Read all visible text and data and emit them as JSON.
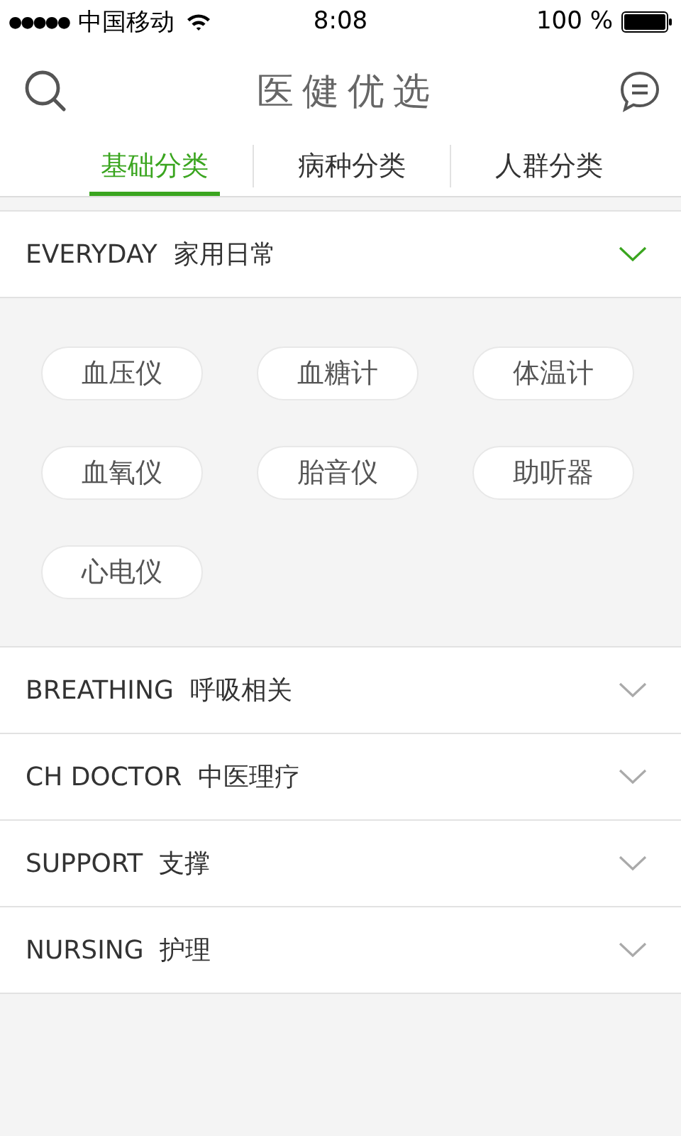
{
  "status_bar": {
    "signal_dots": "●●●●●",
    "carrier": "中国移动",
    "time": "8:08",
    "battery": "100 %"
  },
  "header": {
    "title": "医健优选"
  },
  "tabs": [
    {
      "label": "基础分类",
      "selected": true
    },
    {
      "label": "病种分类",
      "selected": false
    },
    {
      "label": "人群分类",
      "selected": false
    }
  ],
  "sections": [
    {
      "title": "EVERYDAY  家用日常",
      "expanded": true,
      "items": [
        "血压仪",
        "血糖计",
        "体温计",
        "血氧仪",
        "胎音仪",
        "助听器",
        "心电仪"
      ]
    },
    {
      "title": "BREATHING  呼吸相关",
      "expanded": false
    },
    {
      "title": "CH DOCTOR  中医理疗",
      "expanded": false
    },
    {
      "title": "SUPPORT  支撑",
      "expanded": false
    },
    {
      "title": "NURSING  护理",
      "expanded": false
    }
  ]
}
